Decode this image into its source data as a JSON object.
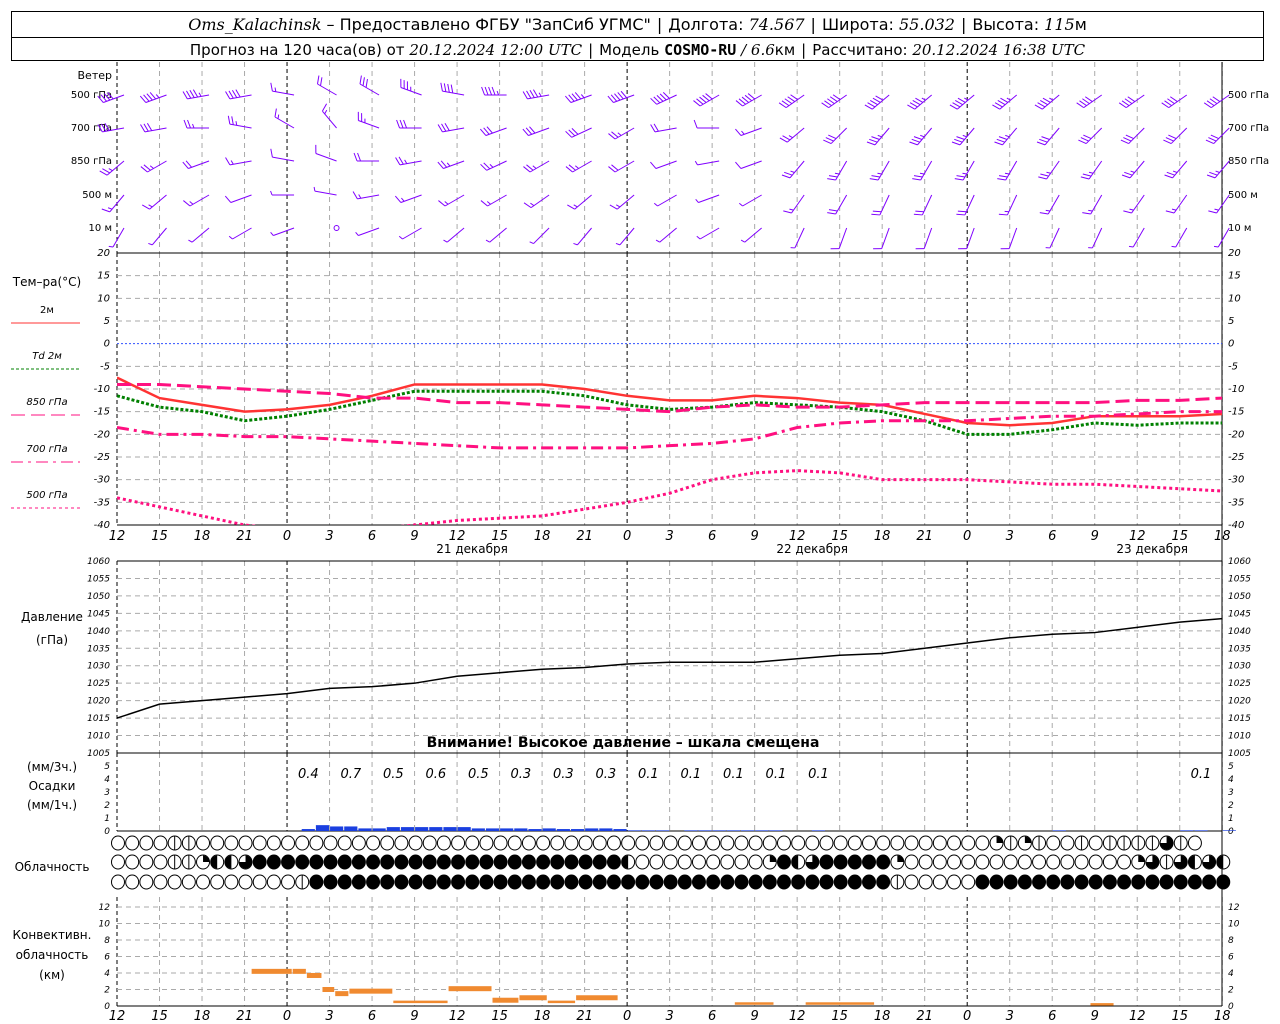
{
  "header": {
    "station": "Oms_Kalachinsk",
    "provider": " – Предоставлено ФГБУ \"ЗапСиб УГМС\"",
    "sep": "|",
    "lon_label": "Долгота: ",
    "lon": "74.567",
    "lat_label": "Широта: ",
    "lat": "55.032",
    "alt_label": "Высота: ",
    "alt": "115",
    "alt_unit": "м",
    "forecast_label": "Прогноз на 120 часа(ов) от ",
    "forecast_time": "20.12.2024 12:00 UTC",
    "model_label": "Модель ",
    "model": "COSMO-RU",
    "res": " / 6.6",
    "res_unit": "км",
    "calc_label": "Рассчитано: ",
    "calc_time": "20.12.2024 16:38 UTC"
  },
  "chart_data": {
    "type": "line",
    "lead_hours": [
      0,
      3,
      6,
      9,
      12,
      15,
      18,
      21,
      24,
      27,
      30,
      33,
      36,
      39,
      42,
      45,
      48,
      51,
      54,
      57,
      60,
      63,
      66,
      69,
      72,
      75,
      78
    ],
    "x_tick_labels": [
      "12",
      "15",
      "18",
      "21",
      "0",
      "3",
      "6",
      "9",
      "12",
      "15",
      "18",
      "21",
      "0",
      "3",
      "6",
      "9",
      "12",
      "15",
      "18",
      "21",
      "0",
      "3",
      "6",
      "9",
      "12",
      "15",
      "18"
    ],
    "midnight_lead_hours": [
      12,
      36,
      60
    ],
    "date_labels": [
      {
        "text": "21 декабря",
        "lead_h": 24
      },
      {
        "text": "22 декабря",
        "lead_h": 48
      },
      {
        "text": "23 декабря",
        "lead_h": 72
      }
    ],
    "wind": {
      "title": "Ветер",
      "levels": [
        {
          "label": "500 гПа",
          "dir": [
            250,
            250,
            260,
            260,
            280,
            300,
            300,
            290,
            280,
            270,
            260,
            250,
            250,
            245,
            240,
            240,
            235,
            235,
            230,
            230,
            230,
            230,
            230,
            235,
            235,
            235,
            235
          ],
          "speed_ms": [
            20,
            22,
            22,
            20,
            8,
            10,
            15,
            18,
            20,
            22,
            22,
            24,
            25,
            25,
            25,
            26,
            26,
            25,
            25,
            24,
            24,
            22,
            22,
            20,
            20,
            20,
            20
          ]
        },
        {
          "label": "700 гПа",
          "dir": [
            260,
            260,
            270,
            280,
            300,
            320,
            290,
            270,
            260,
            250,
            250,
            245,
            240,
            260,
            270,
            250,
            230,
            225,
            220,
            220,
            220,
            220,
            220,
            225,
            225,
            225,
            225
          ],
          "speed_ms": [
            15,
            15,
            14,
            12,
            8,
            8,
            12,
            15,
            16,
            16,
            16,
            16,
            14,
            10,
            6,
            8,
            14,
            16,
            18,
            18,
            18,
            17,
            16,
            15,
            15,
            15,
            15
          ]
        },
        {
          "label": "850 гПа",
          "dir": [
            230,
            240,
            250,
            260,
            280,
            290,
            270,
            260,
            250,
            245,
            240,
            240,
            240,
            250,
            260,
            250,
            220,
            210,
            210,
            210,
            210,
            210,
            215,
            215,
            220,
            220,
            220
          ],
          "speed_ms": [
            12,
            12,
            10,
            8,
            6,
            6,
            10,
            12,
            12,
            12,
            12,
            12,
            10,
            6,
            4,
            6,
            12,
            14,
            14,
            14,
            14,
            13,
            12,
            12,
            12,
            12,
            12
          ]
        },
        {
          "label": "500 м",
          "dir": [
            220,
            230,
            240,
            250,
            270,
            280,
            260,
            250,
            240,
            240,
            235,
            230,
            230,
            240,
            250,
            240,
            215,
            210,
            205,
            205,
            205,
            205,
            210,
            210,
            215,
            215,
            215
          ],
          "speed_ms": [
            8,
            8,
            7,
            6,
            4,
            3,
            7,
            9,
            9,
            9,
            8,
            8,
            7,
            4,
            3,
            4,
            9,
            10,
            10,
            10,
            10,
            9,
            9,
            9,
            9,
            9,
            8
          ]
        },
        {
          "label": "10  м",
          "dir": [
            210,
            220,
            230,
            240,
            250,
            0,
            250,
            240,
            230,
            230,
            225,
            220,
            220,
            230,
            240,
            230,
            205,
            200,
            200,
            200,
            200,
            200,
            205,
            205,
            210,
            210,
            210
          ],
          "speed_ms": [
            4,
            4,
            3,
            3,
            2,
            0,
            3,
            4,
            4,
            4,
            4,
            4,
            3,
            2,
            2,
            2,
            4,
            5,
            5,
            5,
            5,
            5,
            4,
            4,
            4,
            4,
            4
          ]
        }
      ],
      "color": "#8000ff"
    },
    "temperature": {
      "title": "Тем–ра(°С)",
      "ylim": [
        -40,
        20
      ],
      "yticks": [
        "20",
        "15",
        "10",
        "5",
        "0",
        "-5",
        "-10",
        "-15",
        "-20",
        "-25",
        "-30",
        "-35",
        "-40"
      ],
      "series": [
        {
          "name": "2м",
          "color": "#ff3333",
          "values": [
            -7.5,
            -12,
            -13.5,
            -15,
            -14.5,
            -13.5,
            -11.5,
            -9,
            -9,
            -9,
            -9,
            -10,
            -11.5,
            -12.5,
            -12.5,
            -11.5,
            -12,
            -13,
            -13.5,
            -15.5,
            -17.5,
            -18,
            -17.5,
            -16,
            -16,
            -16,
            -15.5
          ]
        },
        {
          "name": "Td  2м",
          "color": "#008000",
          "values": [
            -11.5,
            -14,
            -15,
            -17,
            -16,
            -14.5,
            -12.5,
            -10.5,
            -10.5,
            -10.5,
            -10.5,
            -11.5,
            -13.5,
            -14.5,
            -14,
            -13,
            -13.5,
            -14,
            -15,
            -17,
            -20,
            -20,
            -19,
            -17.5,
            -18,
            -17.5,
            -17.5
          ]
        },
        {
          "name": "850 гПа",
          "color": "#ff1080",
          "values": [
            -9,
            -9,
            -9.5,
            -10,
            -10.5,
            -11,
            -12,
            -12,
            -13,
            -13,
            -13.5,
            -14,
            -14.5,
            -15,
            -14,
            -13.5,
            -14,
            -14,
            -13.5,
            -13,
            -13,
            -13,
            -13,
            -13,
            -12.5,
            -12.5,
            -12
          ]
        },
        {
          "name": "700 гПа",
          "color": "#ff1080",
          "values": [
            -18.5,
            -20,
            -20,
            -20.5,
            -20.5,
            -21,
            -21.5,
            -22,
            -22.5,
            -23,
            -23,
            -23,
            -23,
            -22.5,
            -22,
            -21,
            -18.5,
            -17.5,
            -17,
            -17,
            -17,
            -16.5,
            -16,
            -16,
            -15.5,
            -15,
            -15
          ]
        },
        {
          "name": "500 гПа",
          "color": "#ff1080",
          "values": [
            -34,
            -36,
            -38,
            -40,
            -41,
            -42,
            -41,
            -40,
            -39,
            -38.5,
            -38,
            -36.5,
            -35,
            -33,
            -30,
            -28.5,
            -28,
            -28.5,
            -30,
            -30,
            -30,
            -30.5,
            -31,
            -31,
            -31.5,
            -32,
            -32.5
          ]
        }
      ]
    },
    "pressure": {
      "title": "Давление",
      "unit": "(гПа)",
      "ylim": [
        1005,
        1060
      ],
      "yticks": [
        "1060",
        "1055",
        "1050",
        "1045",
        "1040",
        "1035",
        "1030",
        "1025",
        "1020",
        "1015",
        "1010",
        "1005"
      ],
      "values": [
        1015,
        1019,
        1020,
        1021,
        1022,
        1023.5,
        1024,
        1025,
        1027,
        1028,
        1029,
        1029.5,
        1030.5,
        1031,
        1031,
        1031,
        1032,
        1033,
        1033.5,
        1035,
        1036.5,
        1038,
        1039,
        1039.5,
        1041,
        1042.5,
        1043.5
      ],
      "warning": "Внимание! Высокое давление – шкала смещена",
      "color": "#000000"
    },
    "precipitation": {
      "label_3h": "(мм/3ч.)",
      "title": "Осадки",
      "label_1h": "(мм/1ч.)",
      "ylim": [
        0,
        5
      ],
      "yticks": [
        "0",
        "1",
        "2",
        "3",
        "4",
        "5"
      ],
      "hourly_mm": [
        0,
        0,
        0,
        0,
        0,
        0,
        0,
        0,
        0,
        0,
        0,
        0,
        0,
        0.15,
        0.45,
        0.35,
        0.35,
        0.2,
        0.2,
        0.3,
        0.3,
        0.3,
        0.3,
        0.3,
        0.3,
        0.2,
        0.2,
        0.2,
        0.2,
        0.15,
        0.2,
        0.15,
        0.15,
        0.2,
        0.2,
        0.15,
        0.05,
        0.05,
        0.05,
        0,
        0.05,
        0.05,
        0.05,
        0.05,
        0.05,
        0.05,
        0.05,
        0,
        0,
        0.05,
        0,
        0,
        0,
        0,
        0,
        0,
        0,
        0,
        0,
        0,
        0,
        0,
        0,
        0,
        0,
        0,
        0.05,
        0,
        0,
        0,
        0,
        0,
        0,
        0,
        0,
        0.05,
        0.05,
        0,
        0.05
      ],
      "totals_3h": [
        null,
        null,
        null,
        null,
        "0.4",
        "0.7",
        "0.5",
        "0.6",
        "0.5",
        "0.3",
        "0.3",
        "0.3",
        "0.1",
        "0.1",
        "0.1",
        "0.1",
        "0.1",
        null,
        null,
        null,
        null,
        null,
        null,
        null,
        null,
        "0.1"
      ],
      "color": "#1a3fe0"
    },
    "cloudiness": {
      "title": "Облачность",
      "legend_codes": {
        "O": "clear",
        "l": "trace",
        "q": "quarter",
        "h": "half",
        "t": "three-quarter",
        "F": "overcast"
      },
      "rows": [
        "OOOOllOOOOOOOOOOOOOOOOOOOOOOOOOOOOOOOOOOOOOOOOOOOOOOOOOOOOOOOOqlqlOOlOlllltlO",
        "OOOOllqhhtFFFFFFFFFFFFFFFFFFFFFFFFFFhOOOOOOOOOqFhtFFFFFqOOOOOOOOOOOOOOOOqtlthth",
        "OOOOOOOOOOOOOlFFFFFFFFFFFFFFFFFFFFFFFFFFFFFFFFFFFFFFFFFlOOOOOFFFFFFFFFFFFFFFFFF"
      ]
    },
    "convective": {
      "title_1": "Конвективн.",
      "title_2": "облачность",
      "unit": "(км)",
      "ylim": [
        0,
        13
      ],
      "yticks": [
        "0",
        "2",
        "4",
        "6",
        "8",
        "10",
        "12"
      ],
      "segments": [
        {
          "from_lead_h": 9.5,
          "to_lead_h": 12.4,
          "km": 4.2
        },
        {
          "from_lead_h": 12.4,
          "to_lead_h": 13.4,
          "km": 4.2
        },
        {
          "from_lead_h": 13.4,
          "to_lead_h": 14.5,
          "km": 3.7
        },
        {
          "from_lead_h": 14.5,
          "to_lead_h": 15.4,
          "km": 2.0
        },
        {
          "from_lead_h": 15.4,
          "to_lead_h": 16.4,
          "km": 1.5
        },
        {
          "from_lead_h": 16.4,
          "to_lead_h": 19.5,
          "km": 1.8
        },
        {
          "from_lead_h": 19.5,
          "to_lead_h": 23.4,
          "km": 0.5
        },
        {
          "from_lead_h": 23.4,
          "to_lead_h": 26.5,
          "km": 2.1
        },
        {
          "from_lead_h": 26.5,
          "to_lead_h": 28.4,
          "km": 0.7
        },
        {
          "from_lead_h": 28.4,
          "to_lead_h": 30.4,
          "km": 1.0
        },
        {
          "from_lead_h": 30.4,
          "to_lead_h": 32.4,
          "km": 0.5
        },
        {
          "from_lead_h": 32.4,
          "to_lead_h": 35.4,
          "km": 1.0
        },
        {
          "from_lead_h": 43.6,
          "to_lead_h": 46.4,
          "km": 0.3
        },
        {
          "from_lead_h": 48.6,
          "to_lead_h": 53.5,
          "km": 0.3
        },
        {
          "from_lead_h": 68.7,
          "to_lead_h": 70.4,
          "km": 0.2
        }
      ],
      "color": "#f08a30"
    }
  }
}
